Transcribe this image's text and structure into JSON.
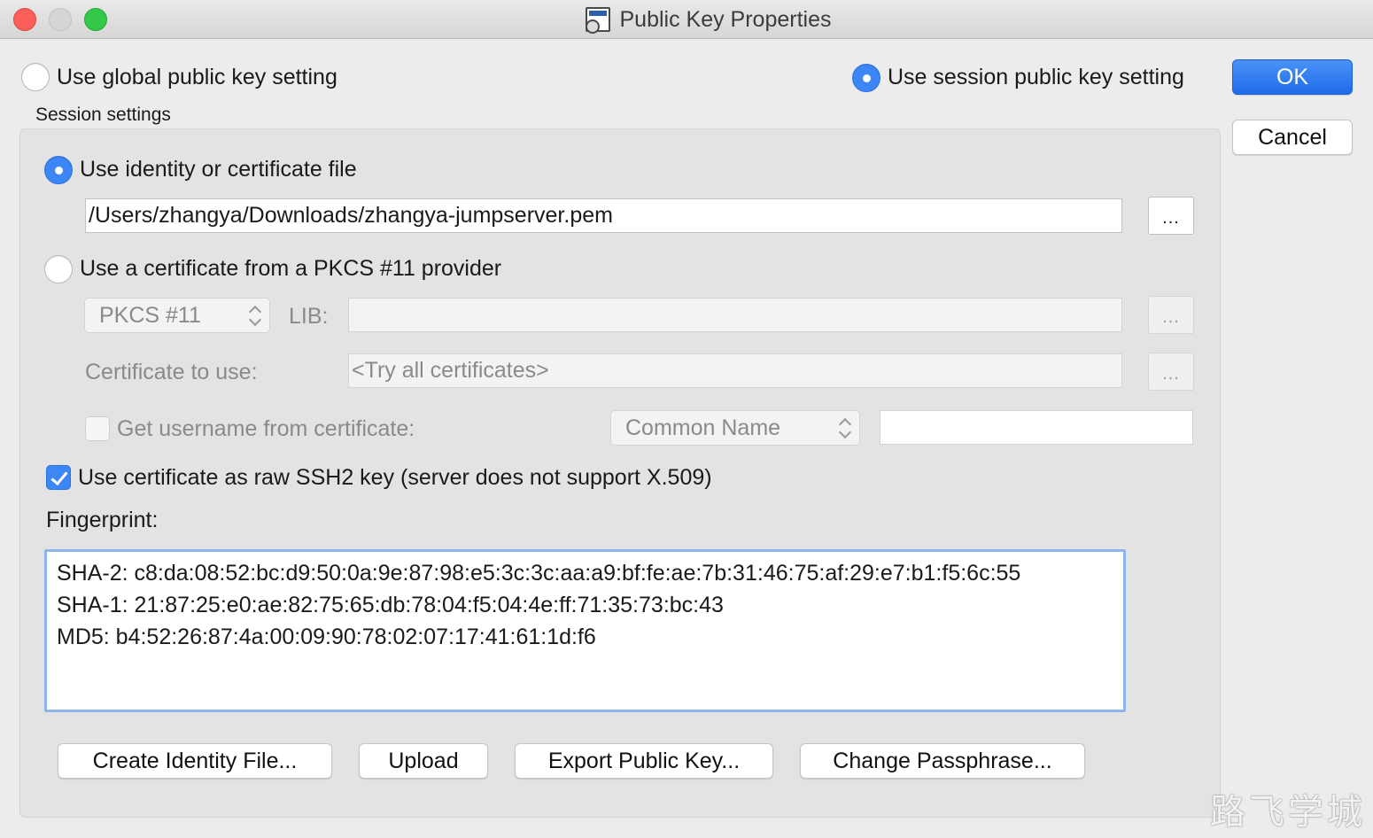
{
  "window": {
    "title": "Public Key Properties"
  },
  "top_options": {
    "global_label": "Use global public key setting",
    "global_selected": false,
    "session_label": "Use session public key setting",
    "session_selected": true
  },
  "buttons": {
    "ok": "OK",
    "cancel": "Cancel"
  },
  "session_settings": {
    "heading": "Session settings",
    "identity_file_label": "Use identity or certificate file",
    "identity_file_selected": true,
    "identity_file_path": "/Users/zhangya/Downloads/zhangya-jumpserver.pem",
    "browse_label": "...",
    "pkcs_label": "Use a certificate from a PKCS #11 provider",
    "pkcs_selected": false,
    "pkcs_select_value": "PKCS #11",
    "lib_label": "LIB:",
    "lib_value": "",
    "cert_to_use_label": "Certificate to use:",
    "cert_to_use_value": "<Try all certificates>",
    "get_username_label": "Get username from certificate:",
    "get_username_checked": false,
    "username_source_value": "Common Name",
    "username_value": "",
    "raw_ssh2_label": "Use certificate as raw SSH2 key (server does not support X.509)",
    "raw_ssh2_checked": true,
    "fingerprint_label": "Fingerprint:",
    "fingerprint_lines": [
      "SHA-2: c8:da:08:52:bc:d9:50:0a:9e:87:98:e5:3c:3c:aa:a9:bf:fe:ae:7b:31:46:75:af:29:e7:b1:f5:6c:55",
      "SHA-1: 21:87:25:e0:ae:82:75:65:db:78:04:f5:04:4e:ff:71:35:73:bc:43",
      "MD5: b4:52:26:87:4a:00:09:90:78:02:07:17:41:61:1d:f6"
    ]
  },
  "bottom_buttons": {
    "create_identity": "Create Identity File...",
    "upload": "Upload",
    "export_public_key": "Export Public Key...",
    "change_passphrase": "Change Passphrase..."
  },
  "watermark": "路飞学城"
}
